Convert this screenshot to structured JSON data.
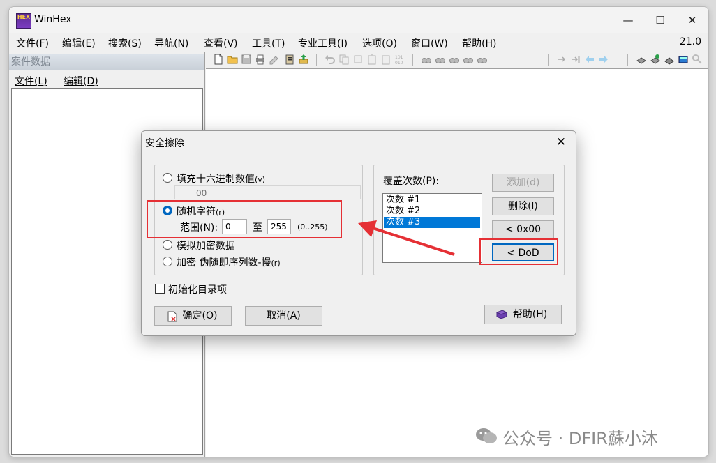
{
  "window": {
    "title": "WinHex",
    "version": "21.0",
    "app_icon_label": "HEX",
    "minimize_glyph": "—",
    "maximize_glyph": "☐",
    "close_glyph": "✕"
  },
  "menu": {
    "items": [
      "文件(F)",
      "编辑(E)",
      "搜索(S)",
      "导航(N)",
      "查看(V)",
      "工具(T)",
      "专业工具(I)",
      "选项(O)",
      "窗口(W)",
      "帮助(H)"
    ]
  },
  "case_panel": {
    "header": "案件数据",
    "menu": [
      "文件(L)",
      "编辑(D)"
    ]
  },
  "dialog": {
    "title": "安全擦除",
    "close_glyph": "✕",
    "options": {
      "fill_hex": {
        "label": "填充十六进制数值",
        "shortcut": "(v)",
        "value": "00"
      },
      "random_chars": {
        "label": "随机字符",
        "shortcut": "(r)",
        "range_label": "范围(N):",
        "from": "0",
        "to_label": "至",
        "to": "255",
        "range_hint": "(0..255)"
      },
      "simulate_encrypted": {
        "label": "模拟加密数据"
      },
      "encrypt_pseudo": {
        "label": "加密 伪随即序列数-慢",
        "shortcut": "(r)"
      }
    },
    "init_dir": {
      "label": "初始化目录项"
    },
    "passes": {
      "label": "覆盖次数(P):",
      "items": [
        "次数 #1",
        "次数 #2",
        "次数 #3"
      ],
      "selected_index": 2
    },
    "buttons": {
      "add": "添加(d)",
      "delete": "删除(l)",
      "zero": "< 0x00",
      "dod": "< DoD",
      "ok": "确定(O)",
      "cancel": "取消(A)",
      "help": "帮助(H)"
    }
  },
  "watermark": "公众号 · DFIR蘇小沐",
  "colors": {
    "accent": "#0078d7",
    "highlight": "#e53035"
  }
}
